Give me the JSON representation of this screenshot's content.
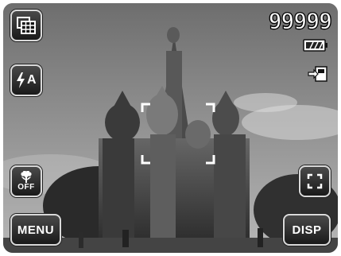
{
  "camera": {
    "shots_remaining": "99999",
    "menu_label": "MENU",
    "disp_label": "DISP",
    "flash_mode_label": "A",
    "macro_state_label": "OFF"
  },
  "icons": {
    "grid": "grid-view-icon",
    "flash": "flash-auto-icon",
    "macro": "macro-off-icon",
    "fullscreen": "fullscreen-icon",
    "battery": "battery-icon",
    "memory": "internal-memory-icon",
    "focus": "focus-frame-icon"
  },
  "colors": {
    "button_border": "#d9d9d9",
    "button_fill": "#2a2a2a",
    "text": "#ffffff"
  }
}
